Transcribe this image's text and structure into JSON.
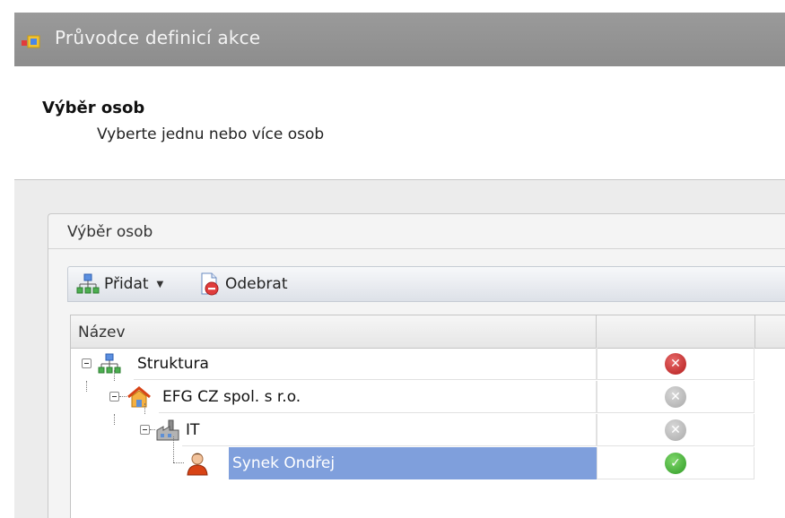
{
  "window": {
    "title": "Průvodce definicí akce",
    "icon": "wizard-app-icon"
  },
  "header": {
    "title": "Výběr osob",
    "subtitle": "Vyberte jednu nebo více osob"
  },
  "group": {
    "title": "Výběr osob"
  },
  "toolbar": {
    "add_label": "Přidat",
    "remove_label": "Odebrat"
  },
  "grid": {
    "columns": [
      "Název",
      ""
    ],
    "rows": [
      {
        "label": "Struktura",
        "icon": "org-structure-icon",
        "status": "remove-active",
        "status_color": "#c42424"
      },
      {
        "label": "EFG CZ spol. s r.o.",
        "icon": "company-house-icon",
        "status": "remove-disabled",
        "status_color": "#b5b5b5"
      },
      {
        "label": "IT",
        "icon": "department-icon",
        "status": "remove-disabled",
        "status_color": "#b5b5b5"
      },
      {
        "label": "Synek Ondřej",
        "icon": "person-icon",
        "status": "ok",
        "status_color": "#3aa52d",
        "selected": true
      }
    ]
  },
  "colors": {
    "titlebar": "#8f8f8f",
    "selection": "#7f9fdc",
    "toolbar": "#e4e8ee"
  }
}
